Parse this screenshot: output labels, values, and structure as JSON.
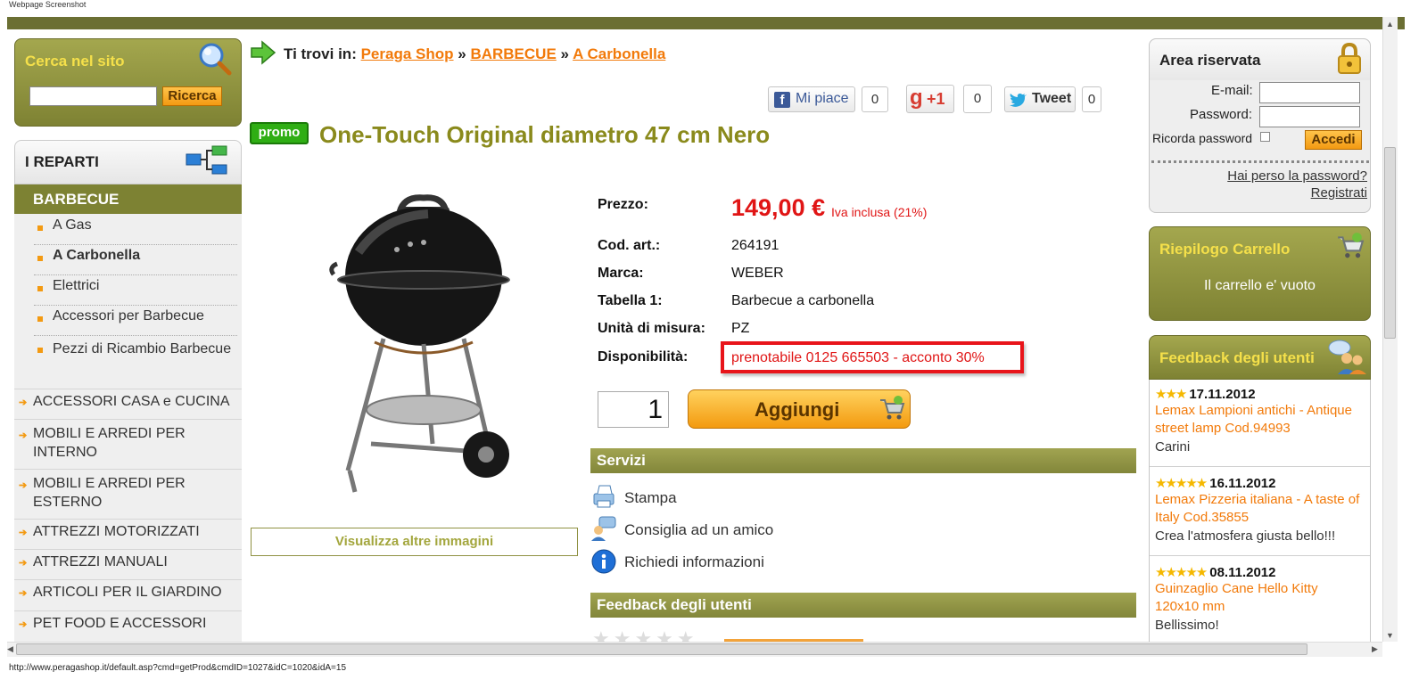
{
  "caption": "Webpage Screenshot",
  "search": {
    "title": "Cerca nel sito",
    "value": "",
    "button": "Ricerca"
  },
  "departments": {
    "title": "I REPARTI",
    "active": "BARBECUE",
    "subitems": [
      "A Gas",
      "A Carbonella",
      "Elettrici",
      "Accessori per Barbecue",
      "Pezzi di Ricambio Barbecue"
    ],
    "categories": [
      "ACCESSORI CASA e CUCINA",
      "MOBILI E ARREDI PER INTERNO",
      "MOBILI E ARREDI PER ESTERNO",
      "ATTREZZI MOTORIZZATI",
      "ATTREZZI MANUALI",
      "ARTICOLI PER IL GIARDINO",
      "PET FOOD E ACCESSORI"
    ]
  },
  "breadcrumb": {
    "prefix": "Ti trovi in:",
    "items": [
      "Peraga Shop",
      "BARBECUE",
      "A Carbonella"
    ],
    "sep": "»"
  },
  "social": {
    "like": "Mi piace",
    "like_count": "0",
    "gplus": "+1",
    "gplus_count": "0",
    "tweet": "Tweet",
    "tweet_count": "0"
  },
  "product": {
    "badge": "promo",
    "title": "One-Touch Original diametro 47 cm Nero",
    "more_images": "Visualizza altre immagini",
    "price_label": "Prezzo:",
    "price": "149,00 €",
    "price_note": "Iva inclusa (21%)",
    "fields": [
      {
        "label": "Cod. art.:",
        "value": "264191"
      },
      {
        "label": "Marca:",
        "value": "WEBER"
      },
      {
        "label": "Tabella 1:",
        "value": "Barbecue a carbonella"
      },
      {
        "label": "Unità di misura:",
        "value": "PZ"
      }
    ],
    "availability_label": "Disponibilità:",
    "availability": "prenotabile 0125 665503 - acconto 30%",
    "quantity": "1",
    "add_button": "Aggiungi"
  },
  "services": {
    "title": "Servizi",
    "items": [
      "Stampa",
      "Consiglia ad un amico",
      "Richiedi informazioni"
    ]
  },
  "feedback_section": {
    "title": "Feedback degli utenti"
  },
  "login": {
    "title": "Area riservata",
    "email_label": "E-mail:",
    "password_label": "Password:",
    "remember": "Ricorda password",
    "button": "Accedi",
    "forgot": "Hai perso la password?",
    "register": "Registrati"
  },
  "cart": {
    "title": "Riepilogo Carrello",
    "empty": "Il carrello e' vuoto"
  },
  "feedback": {
    "title": "Feedback degli utenti",
    "items": [
      {
        "stars": 3,
        "date": "17.11.2012",
        "product": "Lemax Lampioni antichi - Antique street lamp Cod.94993",
        "comment": "Carini"
      },
      {
        "stars": 5,
        "date": "16.11.2012",
        "product": "Lemax Pizzeria italiana - A taste of Italy Cod.35855",
        "comment": "Crea l'atmosfera giusta bello!!!"
      },
      {
        "stars": 5,
        "date": "08.11.2012",
        "product": "Guinzaglio Cane Hello Kitty 120x10 mm",
        "comment": "Bellissimo!"
      }
    ]
  },
  "status_url": "http://www.peragashop.it/default.asp?cmd=getProd&cmdID=1027&idC=1020&idA=15",
  "colors": {
    "olive": "#7d8233",
    "orange": "#f27a0a",
    "price_red": "#e01515",
    "title_olive": "#8a8a1c"
  }
}
